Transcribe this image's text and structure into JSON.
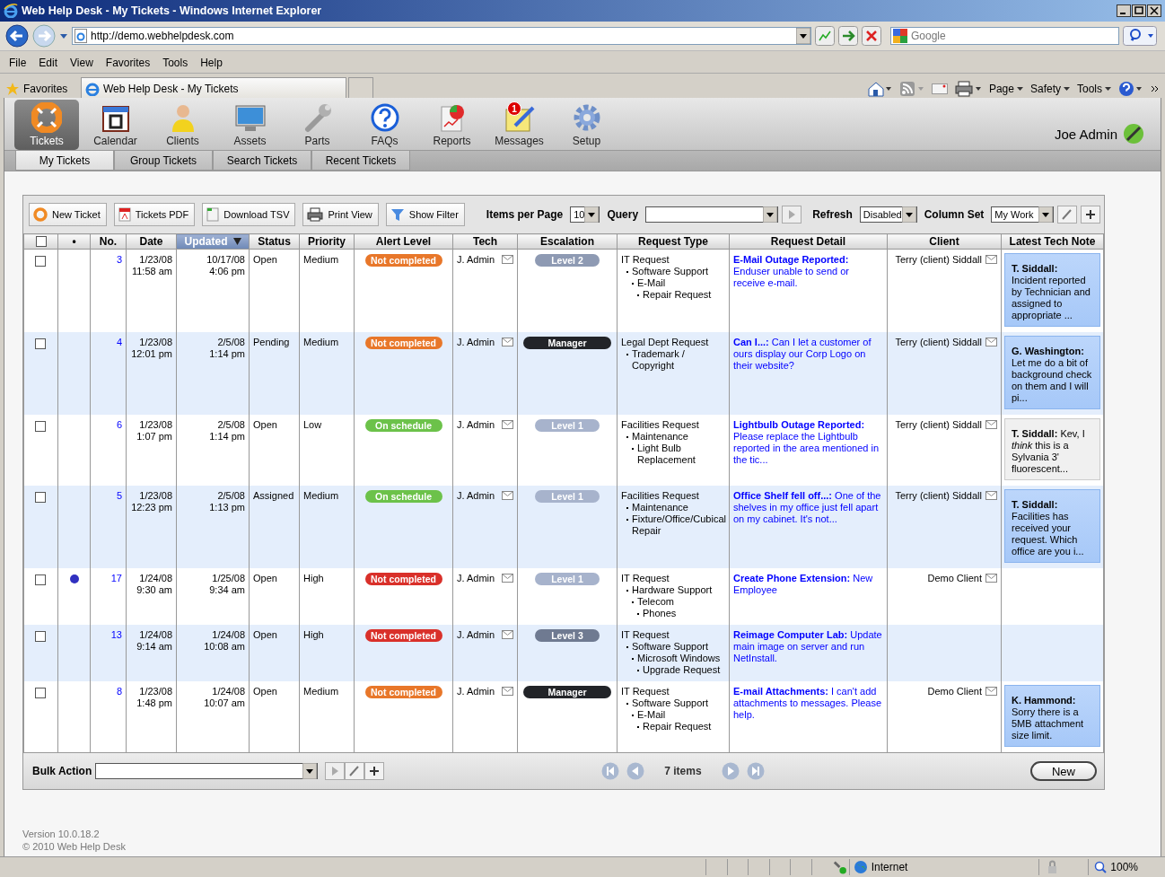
{
  "window": {
    "title": "Web Help Desk - My Tickets - Windows Internet Explorer"
  },
  "address_bar": {
    "url": "http://demo.webhelpdesk.com",
    "search_placeholder": "Google"
  },
  "menu": [
    "File",
    "Edit",
    "View",
    "Favorites",
    "Tools",
    "Help"
  ],
  "favorites_bar": {
    "label": "Favorites",
    "tab": "Web Help Desk - My Tickets",
    "commands": [
      "Page",
      "Safety",
      "Tools"
    ]
  },
  "nav": [
    {
      "label": "Tickets",
      "selected": true
    },
    {
      "label": "Calendar",
      "selected": false
    },
    {
      "label": "Clients",
      "selected": false
    },
    {
      "label": "Assets",
      "selected": false
    },
    {
      "label": "Parts",
      "selected": false
    },
    {
      "label": "FAQs",
      "selected": false
    },
    {
      "label": "Reports",
      "selected": false
    },
    {
      "label": "Messages",
      "selected": false,
      "badge": "1"
    },
    {
      "label": "Setup",
      "selected": false
    }
  ],
  "user": "Joe Admin",
  "subtabs": [
    {
      "label": "My Tickets",
      "selected": true
    },
    {
      "label": "Group Tickets",
      "selected": false
    },
    {
      "label": "Search Tickets",
      "selected": false
    },
    {
      "label": "Recent Tickets",
      "selected": false
    }
  ],
  "toolbar": {
    "buttons": [
      "New Ticket",
      "Tickets PDF",
      "Download TSV",
      "Print View",
      "Show Filter"
    ],
    "items_per_page": {
      "label": "Items per Page",
      "value": "10"
    },
    "query": {
      "label": "Query"
    },
    "refresh": {
      "label": "Refresh",
      "value": "Disabled"
    },
    "column_set": {
      "label": "Column Set",
      "value": "My Work"
    }
  },
  "columns": [
    {
      "sorted": false
    },
    {
      "label": "•",
      "sorted": false
    },
    {
      "label": "No.",
      "sorted": false
    },
    {
      "label": "Date",
      "sorted": false
    },
    {
      "label": "Updated",
      "sorted": true
    },
    {
      "label": "Status",
      "sorted": false
    },
    {
      "label": "Priority",
      "sorted": false
    },
    {
      "label": "Alert Level",
      "sorted": false
    },
    {
      "label": "Tech",
      "sorted": false
    },
    {
      "label": "Escalation",
      "sorted": false
    },
    {
      "label": "Request Type",
      "sorted": false
    },
    {
      "label": "Request Detail",
      "sorted": false
    },
    {
      "label": "Client",
      "sorted": false
    },
    {
      "label": "Latest Tech Note",
      "sorted": false
    }
  ],
  "rows": [
    {
      "checked": false,
      "flagged": false,
      "no": "3",
      "date": "1/23/08",
      "date_time": "11:58 am",
      "updated": "10/17/08",
      "updated_time": "4:06 pm",
      "status": "Open",
      "priority": "Medium",
      "alert": {
        "text": "Not completed",
        "color": "#e8772a"
      },
      "tech": "J. Admin",
      "escalation": {
        "text": "Level 2",
        "color": "#8e9ab3"
      },
      "request_type": [
        {
          "label": "IT Request",
          "children": [
            {
              "label": "Software Support",
              "children": [
                {
                  "label": "E-Mail",
                  "children": [
                    {
                      "label": "Repair Request"
                    }
                  ]
                }
              ]
            }
          ]
        }
      ],
      "detail": "**E-Mail Outage Reported:** Enduser unable to send or receive e-mail.",
      "client": "Terry (client) Siddall",
      "note": {
        "text": "**T. Siddall:** Incident reported by Technician and assigned to appropriate ...",
        "highlighted": true
      }
    },
    {
      "checked": false,
      "flagged": false,
      "no": "4",
      "date": "1/23/08",
      "date_time": "12:01 pm",
      "updated": "2/5/08",
      "updated_time": "1:14 pm",
      "status": "Pending",
      "priority": "Medium",
      "alert": {
        "text": "Not completed",
        "color": "#e8772a"
      },
      "tech": "J. Admin",
      "escalation": {
        "text": "Manager",
        "color": "#222428"
      },
      "request_type": [
        {
          "label": "Legal Dept Request",
          "children": [
            {
              "label": "Trademark / Copyright"
            }
          ]
        }
      ],
      "detail": "**Can I...:** Can I let a customer of ours display our Corp Logo on their website?",
      "client": "Terry (client) Siddall",
      "note": {
        "text": "**G. Washington:** Let me do a bit of background check on them and I will pi...",
        "highlighted": true
      }
    },
    {
      "checked": false,
      "flagged": false,
      "no": "6",
      "date": "1/23/08",
      "date_time": "1:07 pm",
      "updated": "2/5/08",
      "updated_time": "1:14 pm",
      "status": "Open",
      "priority": "Low",
      "alert": {
        "text": "On schedule",
        "color": "#6cc24a"
      },
      "tech": "J. Admin",
      "escalation": {
        "text": "Level 1",
        "color": "#a7b3cc"
      },
      "request_type": [
        {
          "label": "Facilities Request",
          "children": [
            {
              "label": "Maintenance",
              "children": [
                {
                  "label": "Light Bulb Replacement"
                }
              ]
            }
          ]
        }
      ],
      "detail": "**Lightbulb Outage Reported:** Please replace the Lightbulb reported in the area mentioned in the tic...",
      "client": "Terry (client) Siddall",
      "note": {
        "text": "**T. Siddall:** Kev, I *think* this is a Sylvania 3' fluorescent...",
        "highlighted": false
      }
    },
    {
      "checked": false,
      "flagged": false,
      "no": "5",
      "date": "1/23/08",
      "date_time": "12:23 pm",
      "updated": "2/5/08",
      "updated_time": "1:13 pm",
      "status": "Assigned",
      "priority": "Medium",
      "alert": {
        "text": "On schedule",
        "color": "#6cc24a"
      },
      "tech": "J. Admin",
      "escalation": {
        "text": "Level 1",
        "color": "#a7b3cc"
      },
      "request_type": [
        {
          "label": "Facilities Request",
          "children": [
            {
              "label": "Maintenance"
            },
            {
              "label": "Fixture/Office/Cubical Repair"
            }
          ]
        }
      ],
      "detail": "**Office Shelf fell off...:** One of the shelves in my office just fell apart on my cabinet. It's not...",
      "client": "Terry (client) Siddall",
      "note": {
        "text": "**T. Siddall:** Facilities has received your request. Which office are you i...",
        "highlighted": true
      }
    },
    {
      "checked": false,
      "flagged": true,
      "no": "17",
      "date": "1/24/08",
      "date_time": "9:30 am",
      "updated": "1/25/08",
      "updated_time": "9:34 am",
      "status": "Open",
      "priority": "High",
      "alert": {
        "text": "Not completed",
        "color": "#d9302a"
      },
      "tech": "J. Admin",
      "escalation": {
        "text": "Level 1",
        "color": "#a7b3cc"
      },
      "request_type": [
        {
          "label": "IT Request",
          "children": [
            {
              "label": "Hardware Support",
              "children": [
                {
                  "label": "Telecom",
                  "children": [
                    {
                      "label": "Phones"
                    }
                  ]
                }
              ]
            }
          ]
        }
      ],
      "detail": "**Create Phone Extension:** New Employee",
      "client": "Demo Client"
    },
    {
      "checked": false,
      "flagged": false,
      "no": "13",
      "date": "1/24/08",
      "date_time": "9:14 am",
      "updated": "1/24/08",
      "updated_time": "10:08 am",
      "status": "Open",
      "priority": "High",
      "alert": {
        "text": "Not completed",
        "color": "#d9302a"
      },
      "tech": "J. Admin",
      "escalation": {
        "text": "Level 3",
        "color": "#6f7a91"
      },
      "request_type": [
        {
          "label": "IT Request",
          "children": [
            {
              "label": "Software Support",
              "children": [
                {
                  "label": "Microsoft Windows",
                  "children": [
                    {
                      "label": "Upgrade Request"
                    }
                  ]
                }
              ]
            }
          ]
        }
      ],
      "detail": "**Reimage Computer Lab:** Update main image on server and run NetInstall."
    },
    {
      "checked": false,
      "flagged": false,
      "no": "8",
      "date": "1/23/08",
      "date_time": "1:48 pm",
      "updated": "1/24/08",
      "updated_time": "10:07 am",
      "status": "Open",
      "priority": "Medium",
      "alert": {
        "text": "Not completed",
        "color": "#e8772a"
      },
      "tech": "J. Admin",
      "escalation": {
        "text": "Manager",
        "color": "#222428"
      },
      "request_type": [
        {
          "label": "IT Request",
          "children": [
            {
              "label": "Software Support",
              "children": [
                {
                  "label": "E-Mail",
                  "children": [
                    {
                      "label": "Repair Request"
                    }
                  ]
                }
              ]
            }
          ]
        }
      ],
      "detail": "**E-mail Attachments:** I can't add attachments to messages. Please help.",
      "client": "Demo Client",
      "note": {
        "text": "**K. Hammond:** Sorry there is a 5MB attachment size limit.",
        "highlighted": true
      }
    }
  ],
  "footer": {
    "bulk_action_label": "Bulk Action",
    "item_count": "7 items",
    "new_button": "New"
  },
  "version": [
    "Version 10.0.18.2",
    "© 2010 Web Help Desk"
  ],
  "status_bar": {
    "zone": "Internet",
    "zoom": "100%"
  }
}
